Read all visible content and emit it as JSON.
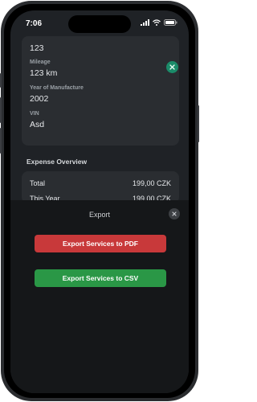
{
  "status_bar": {
    "time": "7:06"
  },
  "vehicle_card": {
    "top_value": "123",
    "mileage_label": "Mileage",
    "mileage_value": "123 km",
    "year_label": "Year of Manufacture",
    "year_value": "2002",
    "vin_label": "VIN",
    "vin_value": "Asd"
  },
  "expense_overview": {
    "title": "Expense Overview",
    "rows": [
      {
        "label": "Total",
        "amount": "199,00 CZK"
      },
      {
        "label": "This Year",
        "amount": "199,00 CZK"
      }
    ]
  },
  "export_sheet": {
    "title": "Export",
    "pdf_button": "Export Services to PDF",
    "csv_button": "Export Services to CSV"
  },
  "colors": {
    "accent_green": "#1b8b69",
    "pdf_red": "#c8393a",
    "csv_green": "#2a9746",
    "card_bg": "#2a2d31",
    "sheet_bg": "#151719"
  }
}
